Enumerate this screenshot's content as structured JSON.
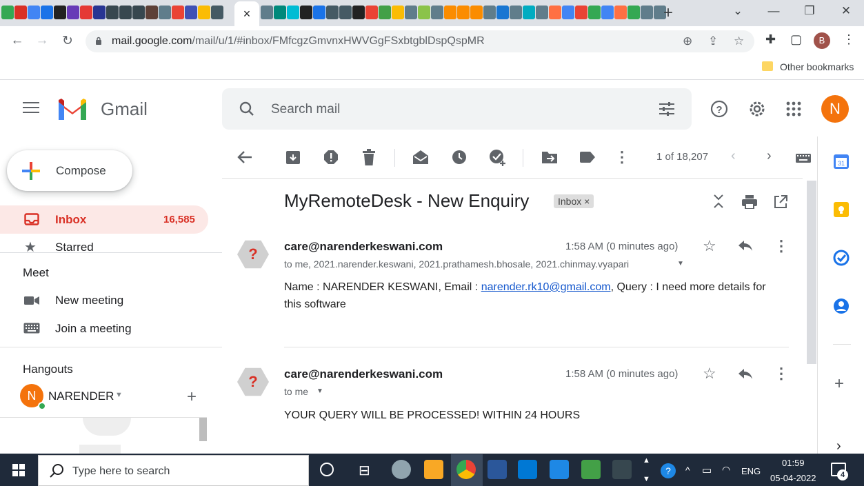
{
  "browser": {
    "active_tab_close": "×",
    "new_tab": "+",
    "window_controls": {
      "minimize": "—",
      "restore": "❐",
      "close": "✕",
      "tabs_menu": "⌄"
    },
    "url": {
      "host": "mail.google.com",
      "path": "/mail/u/1/#inbox/FMfcgzGmvnxHWVGgFSxbtgblDspQspMR"
    },
    "profile_initial": "B",
    "bookmarks": {
      "other": "Other bookmarks"
    }
  },
  "gmail": {
    "brand": "Gmail",
    "search_placeholder": "Search mail",
    "user_initial": "N"
  },
  "sidebar": {
    "compose": "Compose",
    "inbox": {
      "label": "Inbox",
      "count": "16,585"
    },
    "starred": "Starred",
    "meet": {
      "title": "Meet",
      "new_meeting": "New meeting",
      "join_meeting": "Join a meeting"
    },
    "hangouts": {
      "title": "Hangouts",
      "user": "NARENDER",
      "user_initial": "N"
    }
  },
  "toolbar": {
    "pagination": "1 of 18,207"
  },
  "thread": {
    "subject": "MyRemoteDesk - New Enquiry",
    "label_chip": "Inbox ×",
    "messages": [
      {
        "sender": "care@narenderkeswani.com",
        "to": "to me, 2021.narender.keswani, 2021.prathamesh.bhosale, 2021.chinmay.vyapari",
        "time": "1:58 AM (0 minutes ago)",
        "body_prefix": "Name : NARENDER KESWANI, Email : ",
        "body_link": "narender.rk10@gmail.com",
        "body_suffix": ", Query : I need more details for",
        "body_line2": "this software"
      },
      {
        "sender": "care@narenderkeswani.com",
        "to": "to me",
        "time": "1:58 AM (0 minutes ago)",
        "body": "YOUR QUERY WILL BE PROCESSED! WITHIN 24 HOURS"
      }
    ]
  },
  "taskbar": {
    "search_placeholder": "Type here to search",
    "lang": "ENG",
    "time": "01:59",
    "date": "05-04-2022",
    "notifications": "4"
  },
  "colors": {
    "gmail_red": "#ea4335",
    "inbox_highlight": "#fce8e6",
    "user_avatar": "#f4730c",
    "link": "#1155cc"
  }
}
